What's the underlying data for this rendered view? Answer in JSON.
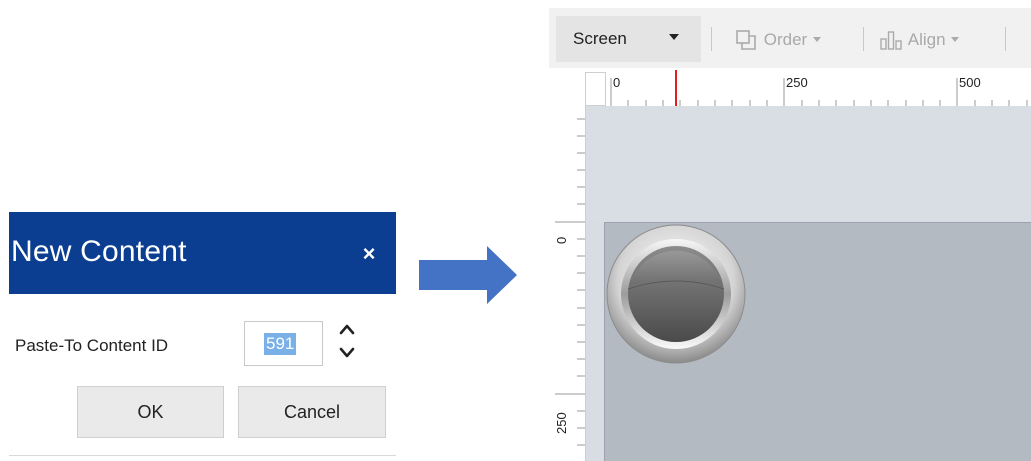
{
  "dialog": {
    "title": "New Content",
    "close_symbol": "×",
    "paste_to_label": "Paste-To Content ID",
    "content_id_value": "591",
    "ok_label": "OK",
    "cancel_label": "Cancel"
  },
  "arrow": {
    "icon": "right-arrow-icon",
    "color": "#4472c4"
  },
  "editor": {
    "toolbar": {
      "screen_label": "Screen",
      "order_label": "Order",
      "align_label": "Align"
    },
    "ruler": {
      "h_labels": [
        "0",
        "250",
        "500"
      ],
      "v_labels": [
        "0",
        "250"
      ],
      "marker_color": "#e02020"
    }
  },
  "colors": {
    "dialog_header": "#0b3d91",
    "selection_highlight": "#7ab0e8",
    "canvas_screen": "#b3bac2"
  }
}
